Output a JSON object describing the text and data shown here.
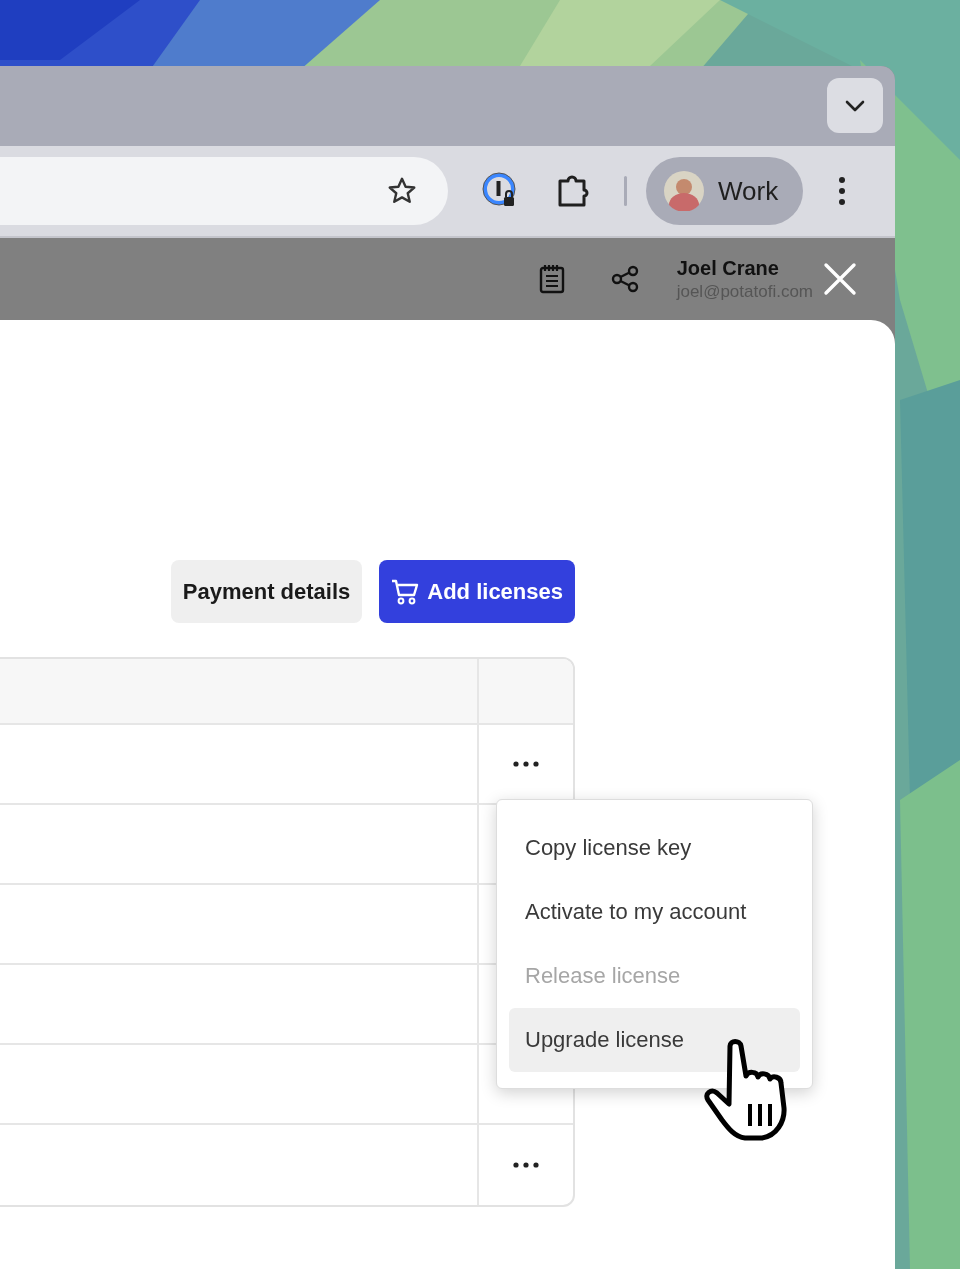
{
  "browser": {
    "profile": {
      "label": "Work"
    }
  },
  "header": {
    "user": {
      "name": "Joel Crane",
      "email": "joel@potatofi.com"
    }
  },
  "actions": {
    "buttons": [
      {
        "label": "Payment details",
        "kind": "secondary"
      },
      {
        "label": "Add licenses",
        "kind": "primary"
      }
    ]
  },
  "table": {
    "rows": [
      {
        "kind": "actions"
      },
      {
        "kind": "plain"
      },
      {
        "kind": "plain"
      },
      {
        "kind": "plain"
      },
      {
        "kind": "plain"
      },
      {
        "kind": "actions"
      }
    ]
  },
  "menu": {
    "items": [
      {
        "label": "Copy license key",
        "disabled": false,
        "highlighted": false
      },
      {
        "label": "Activate to my account",
        "disabled": false,
        "highlighted": false
      },
      {
        "label": "Release license",
        "disabled": true,
        "highlighted": false
      },
      {
        "label": "Upgrade license",
        "disabled": false,
        "highlighted": true
      }
    ]
  }
}
